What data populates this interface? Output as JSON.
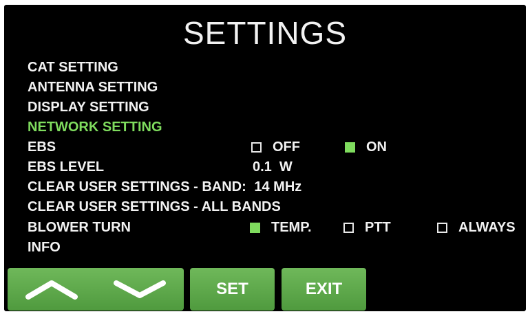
{
  "title": "SETTINGS",
  "accent_color": "#7fdc5e",
  "menu": {
    "cat": "CAT SETTING",
    "antenna": "ANTENNA SETTING",
    "display": "DISPLAY SETTING",
    "network": "NETWORK SETTING"
  },
  "ebs": {
    "label": "EBS",
    "off_label": "OFF",
    "on_label": "ON",
    "selected": "ON"
  },
  "ebs_level": {
    "label": "EBS LEVEL",
    "value": "0.1  W"
  },
  "clear_band": {
    "label": "CLEAR USER SETTINGS - BAND:",
    "value": "14 MHz"
  },
  "clear_all": {
    "label": "CLEAR USER SETTINGS - ALL BANDS"
  },
  "blower": {
    "label": "BLOWER TURN",
    "temp_label": "TEMP.",
    "ptt_label": "PTT",
    "always_label": "ALWAYS",
    "selected": "TEMP."
  },
  "info": {
    "label": "INFO"
  },
  "buttons": {
    "up_icon": "chevron-up-icon",
    "down_icon": "chevron-down-icon",
    "set_label": "SET",
    "exit_label": "EXIT"
  }
}
